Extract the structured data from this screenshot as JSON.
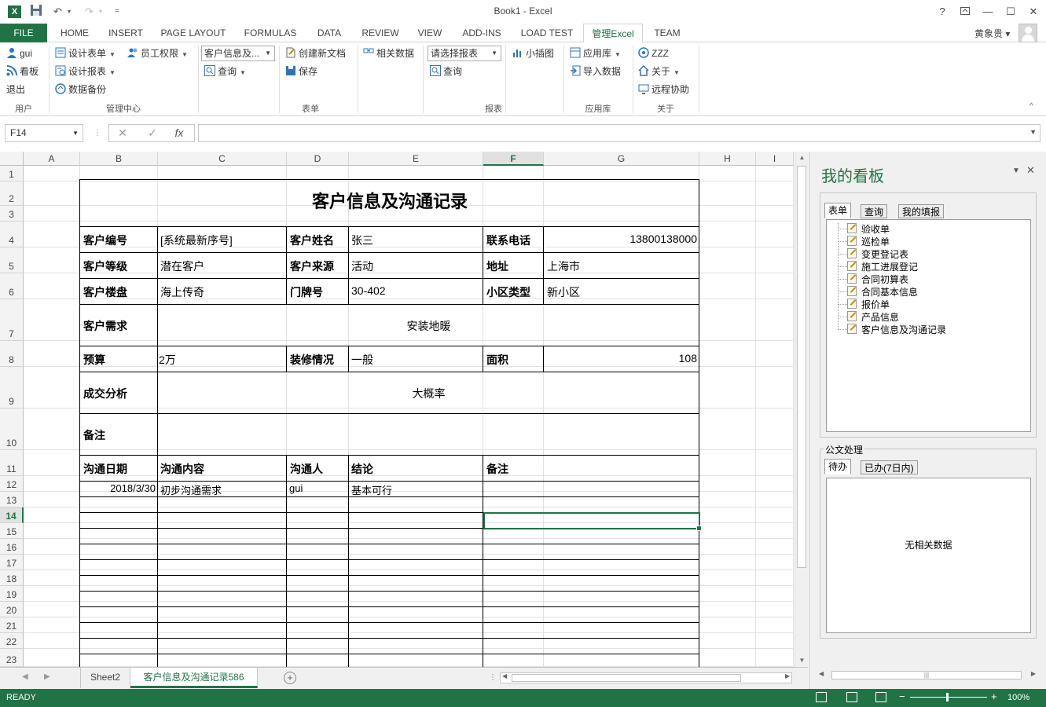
{
  "window": {
    "title": "Book1 - Excel",
    "help": "?",
    "min": "—",
    "max": "☐",
    "close": "✕"
  },
  "quick_access": {
    "undo": "↶",
    "redo": "↷",
    "more": "="
  },
  "tabs": {
    "file": "FILE",
    "items": [
      "HOME",
      "INSERT",
      "PAGE LAYOUT",
      "FORMULAS",
      "DATA",
      "REVIEW",
      "VIEW",
      "ADD-INS",
      "LOAD TEST",
      "管理Excel",
      "TEAM"
    ],
    "active": "管理Excel"
  },
  "user": {
    "name": "黄象贵 ▾"
  },
  "ribbon": {
    "user_group": {
      "label": "用户",
      "items": [
        "gui",
        "看板",
        "退出"
      ]
    },
    "admin_group": {
      "label": "管理中心",
      "design_form": "设计表单",
      "design_report": "设计报表",
      "backup": "数据备份",
      "permissions": "员工权限"
    },
    "form_group": {
      "label": "表单",
      "select_value": "客户信息及...",
      "query": "查询",
      "create_doc": "创建新文档",
      "save": "保存",
      "related": "相关数据"
    },
    "report_group": {
      "label": "报表",
      "select_value": "请选择报表",
      "query": "查询",
      "sparkline": "小插图"
    },
    "app_group": {
      "label": "应用库",
      "app_store": "应用库",
      "import": "导入数据"
    },
    "about_group": {
      "label": "关于",
      "zzz": "ZZZ",
      "about": "关于",
      "remote": "远程协助"
    }
  },
  "formula_bar": {
    "name_box": "F14",
    "cancel": "✕",
    "enter": "✓",
    "fx": "fx",
    "value": ""
  },
  "sheet": {
    "columns": [
      "A",
      "B",
      "C",
      "D",
      "E",
      "F",
      "G",
      "H",
      "I"
    ],
    "rows": [
      "1",
      "2",
      "3",
      "4",
      "5",
      "6",
      "7",
      "8",
      "9",
      "10",
      "11",
      "12",
      "13",
      "14",
      "15",
      "16",
      "17",
      "18",
      "19",
      "20",
      "21",
      "22",
      "23"
    ],
    "selected_col": "F",
    "selected_row": "14",
    "title": "客户信息及沟通记录",
    "fields": {
      "cust_no_label": "客户编号",
      "cust_no": "[系统最新序号]",
      "cust_name_label": "客户姓名",
      "cust_name": "张三",
      "phone_label": "联系电话",
      "phone": "13800138000",
      "level_label": "客户等级",
      "level": "潜在客户",
      "source_label": "客户来源",
      "source": "活动",
      "address_label": "地址",
      "address": "上海市",
      "estate_label": "客户楼盘",
      "estate": "海上传奇",
      "door_label": "门牌号",
      "door": "30-402",
      "district_label": "小区类型",
      "district": "新小区",
      "needs_label": "客户需求",
      "needs": "安装地暖",
      "budget_label": "预算",
      "budget": "2万",
      "decor_label": "装修情况",
      "decor": "一般",
      "area_label": "面积",
      "area": "108",
      "analysis_label": "成交分析",
      "analysis": "大概率",
      "remark_label": "备注",
      "remark": ""
    },
    "log_headers": [
      "沟通日期",
      "沟通内容",
      "沟通人",
      "结论",
      "备注"
    ],
    "log_rows": [
      [
        "2018/3/30",
        "初步沟通需求",
        "gui",
        "基本可行",
        ""
      ]
    ]
  },
  "sheet_tabs": {
    "items": [
      "Sheet2",
      "客户信息及沟通记录586"
    ],
    "active": "客户信息及沟通记录586",
    "add": "+"
  },
  "status": {
    "text": "READY",
    "zoom": "100%",
    "minus": "−",
    "plus": "+"
  },
  "pane": {
    "title": "我的看板",
    "forms_tabs": [
      "表单",
      "查询",
      "我的填报"
    ],
    "forms_active": "表单",
    "form_items": [
      "验收单",
      "巡检单",
      "变更登记表",
      "施工进展登记",
      "合同初算表",
      "合同基本信息",
      "报价单",
      "产品信息",
      "客户信息及沟通记录"
    ],
    "docs_label": "公文处理",
    "docs_tabs": [
      "待办",
      "已办(7日内)"
    ],
    "docs_active": "待办",
    "empty": "无相关数据"
  }
}
